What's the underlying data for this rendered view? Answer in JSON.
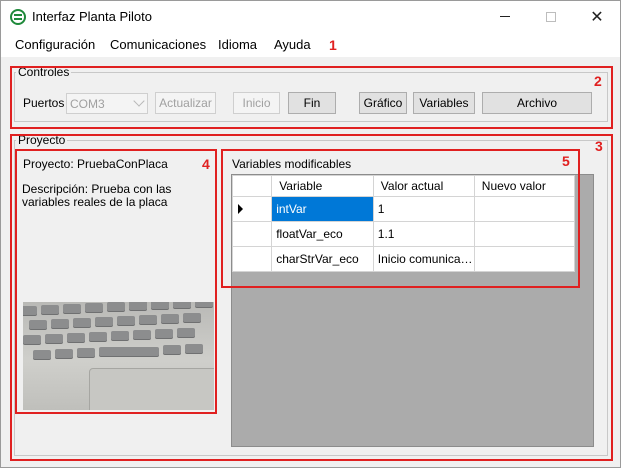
{
  "window": {
    "title": "Interfaz Planta Piloto",
    "close_glyph": "✕"
  },
  "menu": [
    "Configuración",
    "Comunicaciones",
    "Idioma",
    "Ayuda"
  ],
  "annotations": [
    "1",
    "2",
    "3",
    "4",
    "5"
  ],
  "controles": {
    "group_label": "Controles",
    "puertos_label": "Puertos",
    "puerto_selected": "COM3",
    "buttons": {
      "actualizar": "Actualizar",
      "inicio": "Inicio",
      "fin": "Fin",
      "grafico": "Gráfico",
      "variables": "Variables",
      "archivo": "Archivo"
    }
  },
  "proyecto": {
    "group_label": "Proyecto",
    "nombre": "Proyecto: PruebaConPlaca",
    "descripcion": "Descripción: Prueba con las variables reales de la placa",
    "variables_title": "Variables modificables",
    "columns": [
      "Variable",
      "Valor actual",
      "Nuevo valor"
    ],
    "rows": [
      {
        "variable": "intVar",
        "valor_actual": "1",
        "nuevo_valor": ""
      },
      {
        "variable": "floatVar_eco",
        "valor_actual": "1.1",
        "nuevo_valor": ""
      },
      {
        "variable": "charStrVar_eco",
        "valor_actual": "Inicio comunicaci...",
        "nuevo_valor": ""
      }
    ]
  },
  "colors": {
    "annotation": "#e02020",
    "selection": "#0078d7",
    "grid_background": "#ababab"
  },
  "icons": [
    "app-icon",
    "minimize-icon",
    "maximize-icon",
    "close-icon",
    "chevron-down-icon",
    "row-pointer-icon"
  ]
}
